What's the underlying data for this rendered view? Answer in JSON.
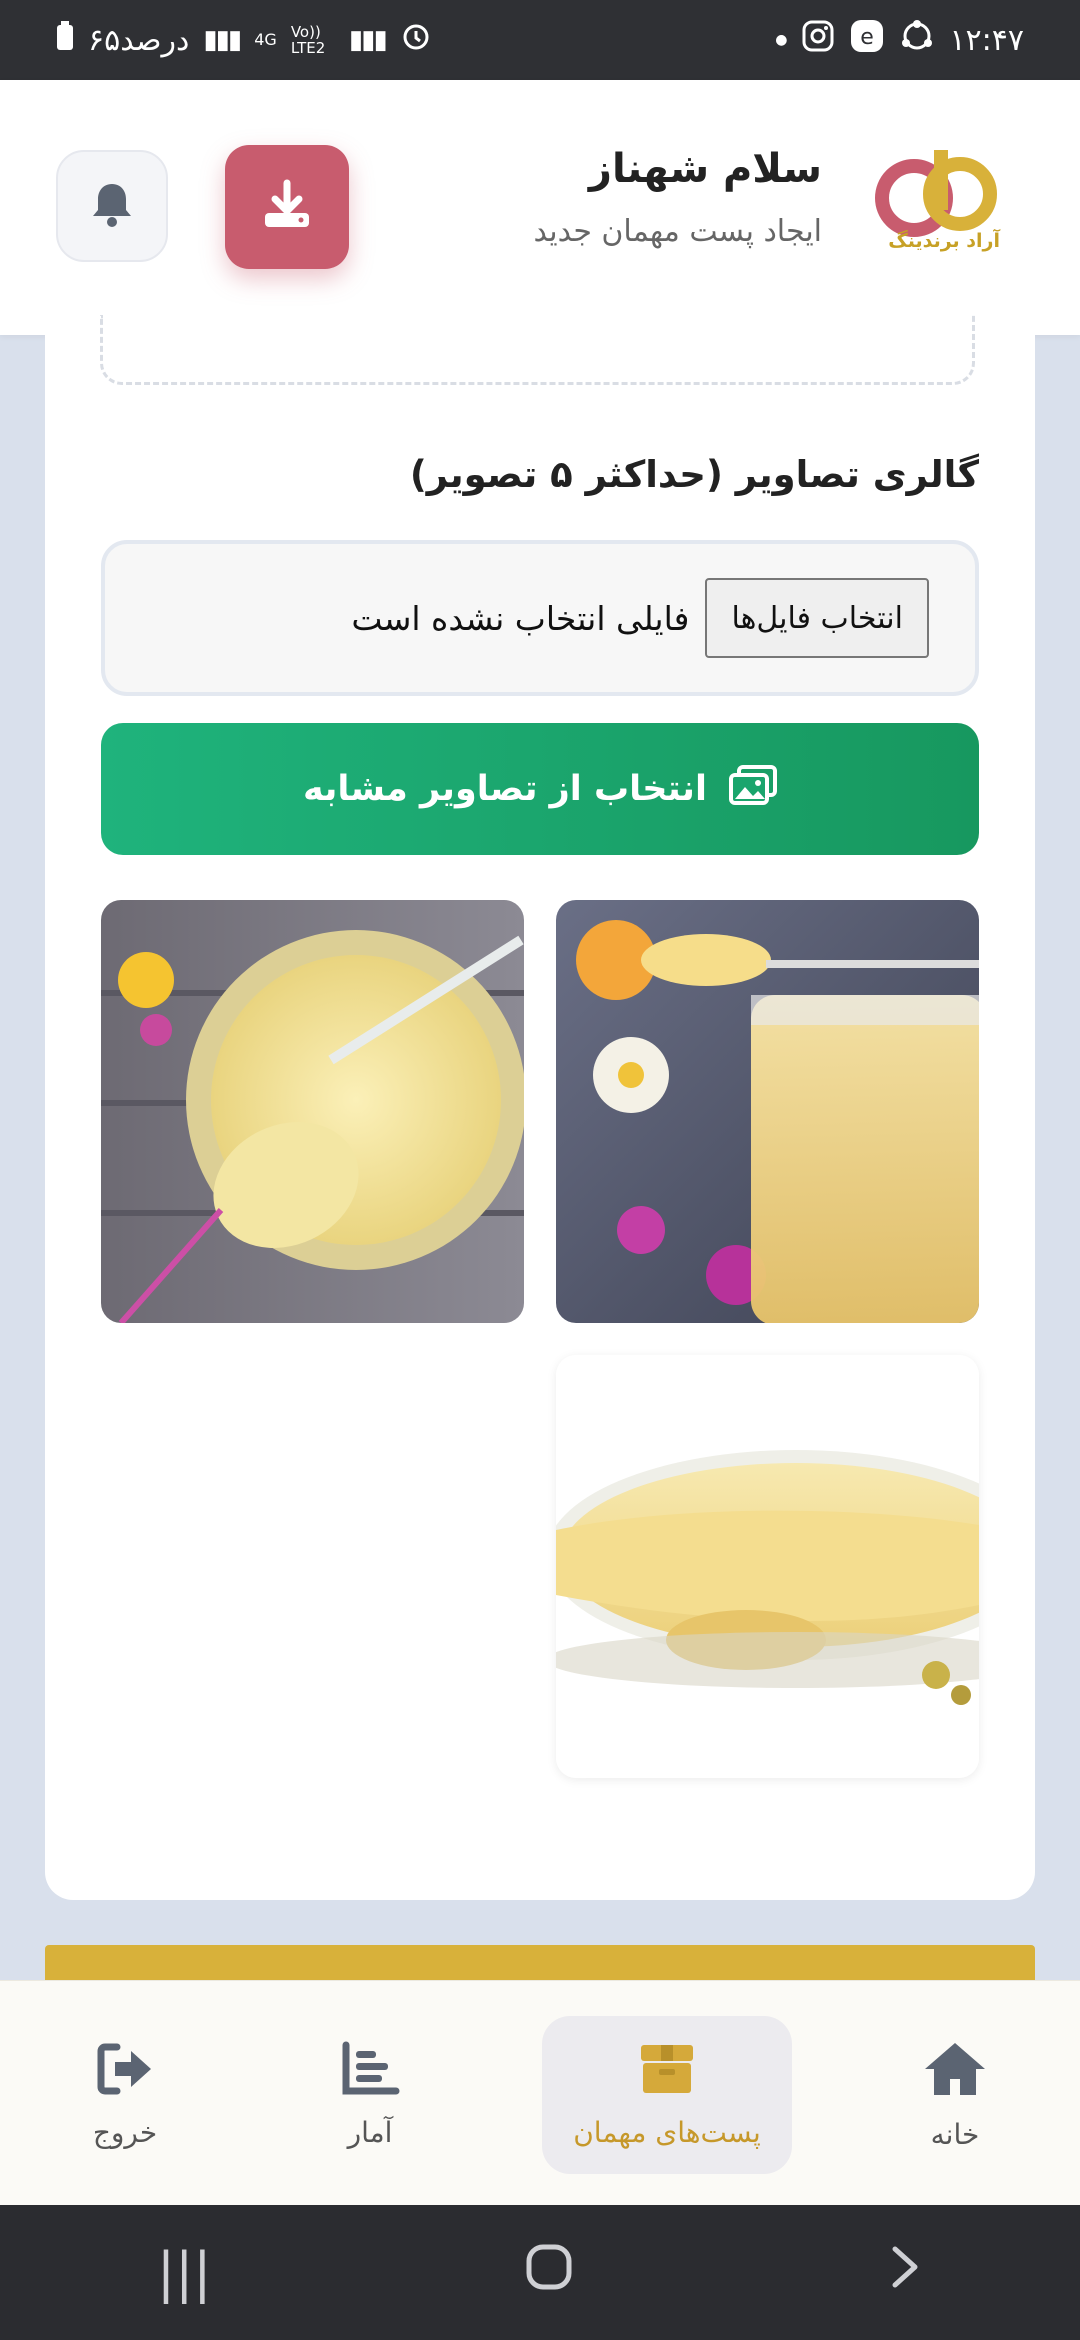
{
  "status_bar": {
    "time": "۱۲:۴۷",
    "battery_text": "۶۵درصد",
    "network_4g": "4G",
    "network_volte": "Vo)) LTE2"
  },
  "header": {
    "greeting": "سلام شهناز",
    "subtitle": "ایجاد پست مهمان جدید",
    "logo_caption": "آراد برندینگ",
    "download_icon": "download-icon",
    "bell_icon": "bell-icon"
  },
  "gallery": {
    "title": "گالری تصاویر (حداکثر ۵ تصویر)",
    "file_button_label": "انتخاب فایل‌ها",
    "file_status": "فایلی انتخاب نشده است",
    "similar_button_label": "انتخاب از تصاویر مشابه",
    "images": [
      {
        "subject": "royal jelly jar with spoon and flowers"
      },
      {
        "subject": "royal jelly jar top view with spoon"
      },
      {
        "subject": "royal jelly in glass bowl"
      }
    ]
  },
  "bottom_nav": {
    "items": [
      {
        "label": "خانه",
        "icon": "home-icon"
      },
      {
        "label": "پست‌های مهمان",
        "icon": "box-icon",
        "active": true
      },
      {
        "label": "آمار",
        "icon": "stats-icon"
      },
      {
        "label": "خروج",
        "icon": "logout-icon"
      }
    ]
  },
  "colors": {
    "accent_green": "#1fb37c",
    "download_red": "#c85c6e",
    "gold": "#d8b13a",
    "active_nav": "#c6982a"
  }
}
